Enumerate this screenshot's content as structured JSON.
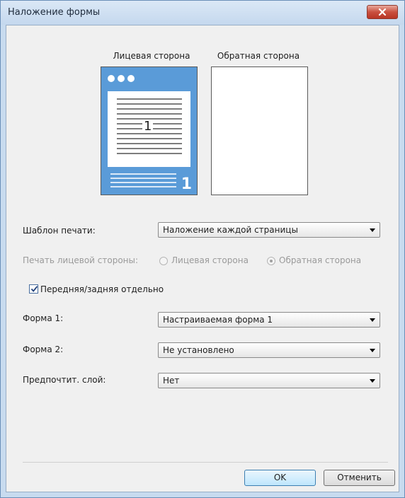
{
  "window": {
    "title": "Наложение формы"
  },
  "preview": {
    "front_label": "Лицевая сторона",
    "back_label": "Обратная сторона",
    "front_page_number": "1",
    "inner_page_number": "1"
  },
  "print_template": {
    "label": "Шаблон печати:",
    "value": "Наложение каждой страницы"
  },
  "front_side_print": {
    "label": "Печать лицевой стороны:",
    "option_front": "Лицевая сторона",
    "option_back": "Обратная сторона",
    "selected": "Обратная сторона",
    "enabled": false
  },
  "separate_checkbox": {
    "label": "Передняя/задняя отдельно",
    "checked": true
  },
  "form1": {
    "label": "Форма 1:",
    "value": "Настраиваемая форма 1"
  },
  "form2": {
    "label": "Форма 2:",
    "value": "Не установлено"
  },
  "priority_layer": {
    "label": "Предпочтит. слой:",
    "value": "Нет"
  },
  "buttons": {
    "ok": "OK",
    "cancel": "Отменить"
  },
  "colors": {
    "preview_blue": "#5a9bd8",
    "title_bar": "#c4d8ee",
    "close_button": "#c9503f"
  }
}
